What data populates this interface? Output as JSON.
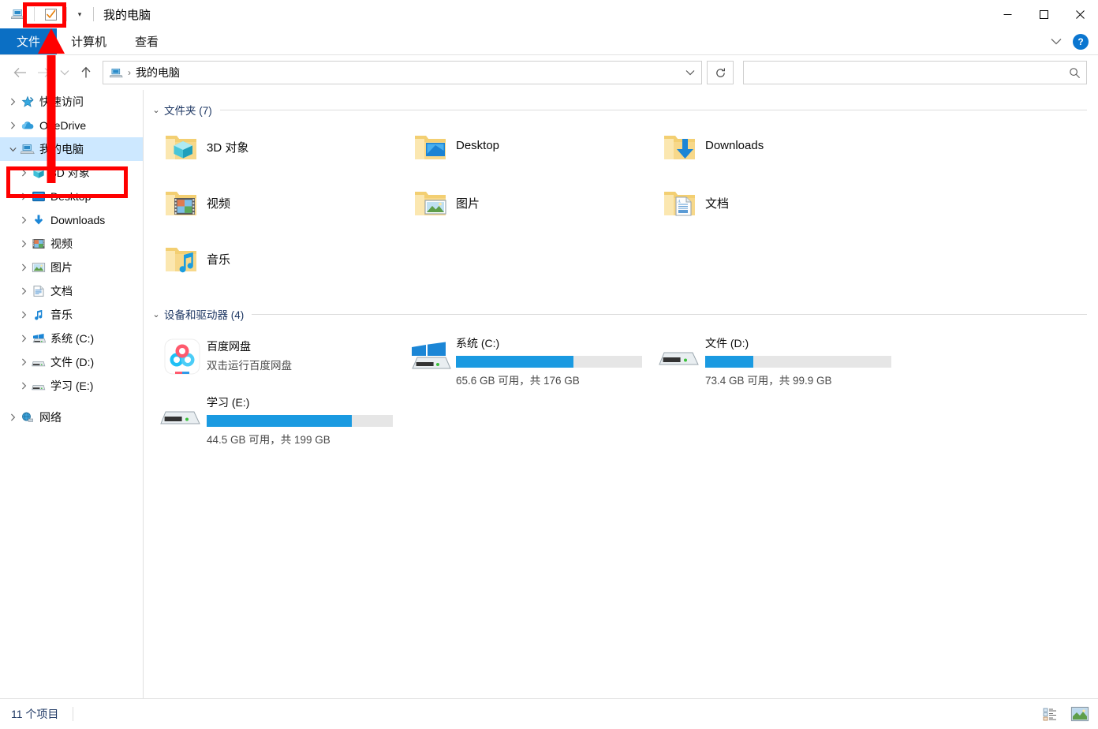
{
  "window": {
    "title": "我的电脑",
    "qat_icons": [
      "properties-checkbox-icon",
      "dropdown-icon"
    ],
    "controls": {
      "minimize": "—",
      "maximize": "▢",
      "close": "✕"
    }
  },
  "ribbon": {
    "tabs": [
      {
        "label": "文件",
        "active": true,
        "name": "tab-file"
      },
      {
        "label": "计算机",
        "active": false,
        "name": "tab-computer"
      },
      {
        "label": "查看",
        "active": false,
        "name": "tab-view"
      }
    ],
    "collapse_icon": "chevron-down-icon",
    "help_label": "?"
  },
  "nav": {
    "back": "←",
    "forward": "→",
    "recent": "⌄",
    "up": "↑",
    "breadcrumb": {
      "icon": "this-pc-icon",
      "separator": "›",
      "text": "我的电脑"
    },
    "address_dropdown": "⌄",
    "refresh": "↻",
    "search": {
      "value": "",
      "placeholder": "",
      "icon": "search-icon"
    }
  },
  "sidebar": {
    "items": [
      {
        "label": "快速访问",
        "icon": "pin-star-icon",
        "chevron": "›",
        "indent": 0,
        "selected": false,
        "name": "sidebar-item-quick-access"
      },
      {
        "label": "OneDrive",
        "icon": "cloud-icon",
        "chevron": "›",
        "indent": 0,
        "selected": false,
        "name": "sidebar-item-onedrive"
      },
      {
        "label": "我的电脑",
        "icon": "this-pc-icon",
        "chevron": "⌄",
        "indent": 0,
        "selected": true,
        "name": "sidebar-item-this-pc"
      },
      {
        "label": "3D 对象",
        "icon": "3d-objects-icon",
        "chevron": "›",
        "indent": 1,
        "selected": false,
        "name": "sidebar-item-3d-objects"
      },
      {
        "label": "Desktop",
        "icon": "desktop-icon",
        "chevron": "›",
        "indent": 1,
        "selected": false,
        "name": "sidebar-item-desktop"
      },
      {
        "label": "Downloads",
        "icon": "downloads-icon",
        "chevron": "›",
        "indent": 1,
        "selected": false,
        "name": "sidebar-item-downloads"
      },
      {
        "label": "视频",
        "icon": "videos-icon",
        "chevron": "›",
        "indent": 1,
        "selected": false,
        "name": "sidebar-item-videos"
      },
      {
        "label": "图片",
        "icon": "pictures-icon",
        "chevron": "›",
        "indent": 1,
        "selected": false,
        "name": "sidebar-item-pictures"
      },
      {
        "label": "文档",
        "icon": "documents-icon",
        "chevron": "›",
        "indent": 1,
        "selected": false,
        "name": "sidebar-item-documents"
      },
      {
        "label": "音乐",
        "icon": "music-icon",
        "chevron": "›",
        "indent": 1,
        "selected": false,
        "name": "sidebar-item-music"
      },
      {
        "label": "系统 (C:)",
        "icon": "windows-drive-icon",
        "chevron": "›",
        "indent": 1,
        "selected": false,
        "name": "sidebar-item-drive-c"
      },
      {
        "label": "文件 (D:)",
        "icon": "drive-icon",
        "chevron": "›",
        "indent": 1,
        "selected": false,
        "name": "sidebar-item-drive-d"
      },
      {
        "label": "学习 (E:)",
        "icon": "drive-icon",
        "chevron": "›",
        "indent": 1,
        "selected": false,
        "name": "sidebar-item-drive-e"
      },
      {
        "label": "网络",
        "icon": "network-icon",
        "chevron": "›",
        "indent": 0,
        "selected": false,
        "name": "sidebar-item-network"
      }
    ]
  },
  "main": {
    "folders_group": {
      "chevron": "⌄",
      "title": "文件夹",
      "count": "(7)",
      "items": [
        {
          "label": "3D 对象",
          "icon": "folder-3d-objects-icon"
        },
        {
          "label": "Desktop",
          "icon": "folder-desktop-icon"
        },
        {
          "label": "Downloads",
          "icon": "folder-downloads-icon"
        },
        {
          "label": "视频",
          "icon": "folder-videos-icon"
        },
        {
          "label": "图片",
          "icon": "folder-pictures-icon"
        },
        {
          "label": "文档",
          "icon": "folder-documents-icon"
        },
        {
          "label": "音乐",
          "icon": "folder-music-icon"
        }
      ]
    },
    "devices_group": {
      "chevron": "⌄",
      "title": "设备和驱动器",
      "count": "(4)",
      "app": {
        "name": "百度网盘",
        "subtitle": "双击运行百度网盘",
        "icon": "baidu-netdisk-icon"
      },
      "drives": [
        {
          "label": "系统 (C:)",
          "icon": "windows-drive-icon",
          "free_text": "65.6 GB 可用，共 176 GB",
          "free_gb": 65.6,
          "total_gb": 176,
          "used_percent": 63,
          "low_space": false
        },
        {
          "label": "文件 (D:)",
          "icon": "drive-icon",
          "free_text": "73.4 GB 可用，共 99.9 GB",
          "free_gb": 73.4,
          "total_gb": 99.9,
          "used_percent": 26,
          "low_space": false
        },
        {
          "label": "学习 (E:)",
          "icon": "drive-icon",
          "free_text": "44.5 GB 可用，共 199 GB",
          "free_gb": 44.5,
          "total_gb": 199,
          "used_percent": 78,
          "low_space": false
        }
      ]
    }
  },
  "status": {
    "item_count": "11 个项目",
    "views": [
      {
        "icon": "details-view-icon",
        "name": "details-view-button"
      },
      {
        "icon": "large-icons-view-icon",
        "name": "large-icons-view-button"
      }
    ]
  },
  "annotations": {
    "color": "#ff0000",
    "box_qat": "properties-checkbox-highlight",
    "box_sidebar": "this-pc-highlight",
    "arrow": "arrow-from-this-pc-to-quick-access-toolbar"
  }
}
